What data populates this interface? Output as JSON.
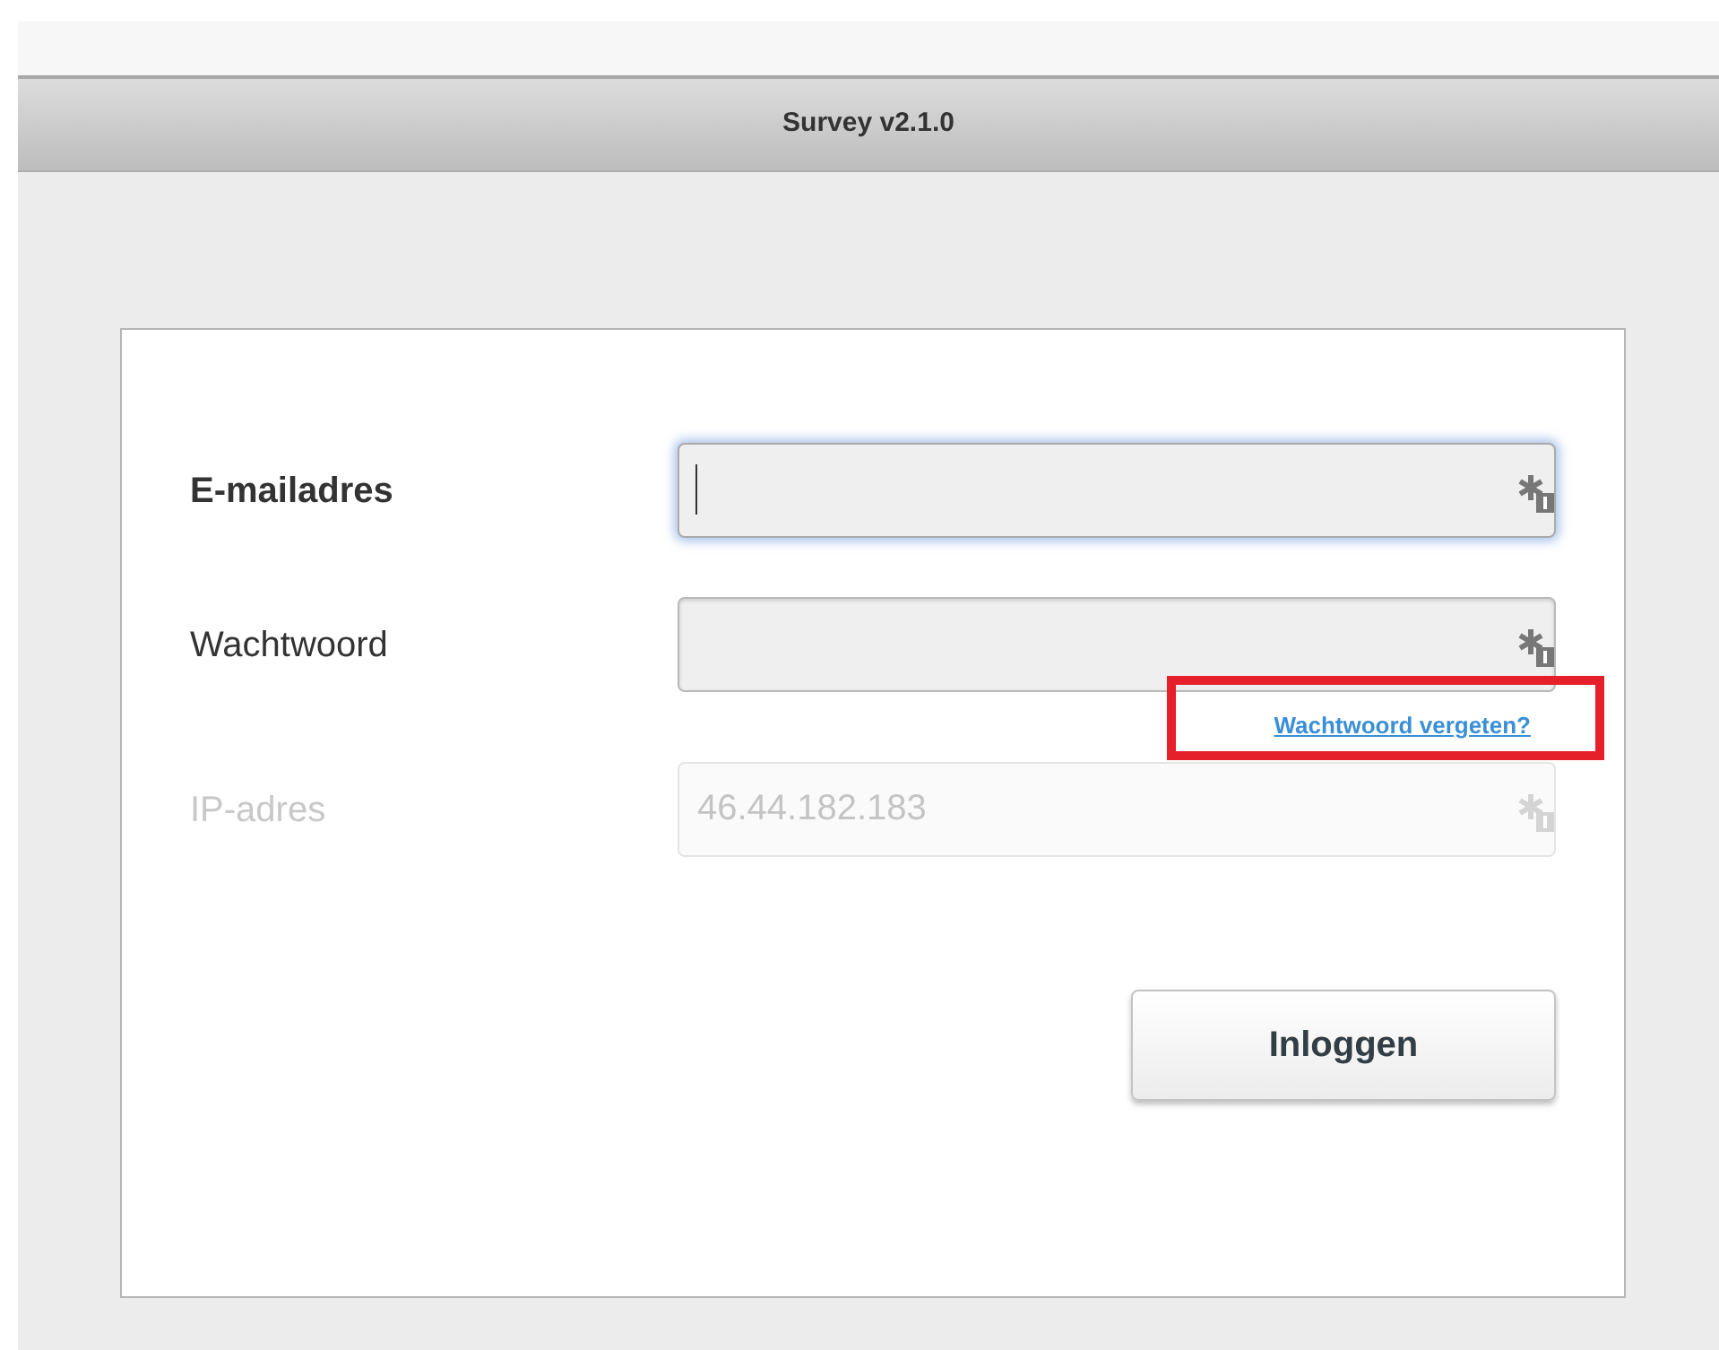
{
  "window": {
    "title": "Survey v2.1.0"
  },
  "fields": [
    {
      "label": "E-mailadres",
      "focused": true,
      "disabled": false
    },
    {
      "label": "Wachtwoord",
      "focused": false,
      "disabled": false,
      "link": "Wachtwoord vergeten?"
    },
    {
      "label": "IP-adres",
      "focused": false,
      "disabled": true,
      "value": "46.44.182.183"
    }
  ],
  "highlight": {
    "shown": true
  },
  "buttons": [
    "Inloggen"
  ]
}
